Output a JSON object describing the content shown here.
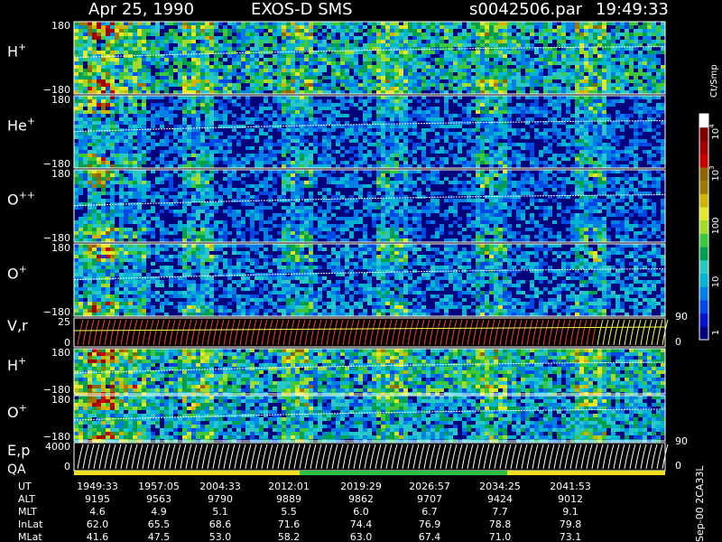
{
  "header": {
    "date": "Apr 25, 1990",
    "instrument": "EXOS-D SMS",
    "file": "s0042506.par",
    "time": "19:49:33"
  },
  "footer_tag": "Sep-00 2CA33L",
  "chart_data": {
    "type": "heatmap",
    "panels": [
      {
        "label": "H",
        "sup": "+",
        "y_top": "180",
        "y_bottom": "−180",
        "kind": "spec",
        "bg": 0.1,
        "noise": 0.45
      },
      {
        "label": "He",
        "sup": "+",
        "y_top": "180",
        "y_bottom": "−180",
        "kind": "spec",
        "bg": 0.06,
        "noise": 0.25
      },
      {
        "label": "O",
        "sup": "++",
        "y_top": "180",
        "y_bottom": "−180",
        "kind": "spec",
        "bg": 0.05,
        "noise": 0.25
      },
      {
        "label": "O",
        "sup": "+",
        "y_top": "180",
        "y_bottom": "−180",
        "kind": "spec",
        "bg": 0.06,
        "noise": 0.3
      },
      {
        "label": "V,r",
        "sup": "",
        "y_top": "25",
        "y_bottom": "0",
        "right_top": "90",
        "right_bottom": "0",
        "kind": "vr"
      },
      {
        "label": "H",
        "sup": "+",
        "y_top": "180",
        "y_bottom": "−180",
        "kind": "spec",
        "bg": 0.12,
        "noise": 0.45
      },
      {
        "label": "O",
        "sup": "+",
        "y_top": "180",
        "y_bottom": "−180",
        "kind": "spec",
        "bg": 0.1,
        "noise": 0.35
      },
      {
        "label": "E,p",
        "sup": "",
        "label2": "QA",
        "y_top": "4000",
        "y_bottom": "0",
        "right_top": "90",
        "right_bottom": "0",
        "kind": "ep"
      }
    ],
    "colorbar": {
      "unit": "Ct/Smp",
      "ticks": [
        "1",
        "10",
        "100",
        "10",
        "10"
      ],
      "tick_exponents": [
        "",
        "",
        "",
        "3",
        "4"
      ],
      "colors": [
        "#00007a",
        "#0015c8",
        "#0048e6",
        "#0080e6",
        "#00b4d2",
        "#28c8c8",
        "#00a050",
        "#3cc83c",
        "#a0dc28",
        "#e6e628",
        "#d2b400",
        "#a07800",
        "#8c6400",
        "#c80000",
        "#a00000",
        "#800000",
        "#ffffff"
      ]
    },
    "time_axis": {
      "rows": [
        {
          "label": "UT",
          "values": [
            "1949:33",
            "1957:05",
            "2004:33",
            "2012:01",
            "2019:29",
            "2026:57",
            "2034:25",
            "2041:53"
          ]
        },
        {
          "label": "ALT",
          "values": [
            "9195",
            "9563",
            "9790",
            "9889",
            "9862",
            "9707",
            "9424",
            "9012"
          ]
        },
        {
          "label": "MLT",
          "values": [
            "4.6",
            "4.9",
            "5.1",
            "5.5",
            "6.0",
            "6.7",
            "7.7",
            "9.1"
          ]
        },
        {
          "label": "InLat",
          "values": [
            "62.0",
            "65.5",
            "68.6",
            "71.6",
            "74.4",
            "76.9",
            "78.8",
            "79.8"
          ]
        },
        {
          "label": "MLat",
          "values": [
            "41.6",
            "47.5",
            "53.0",
            "58.2",
            "63.0",
            "67.4",
            "71.0",
            "73.1"
          ]
        }
      ]
    }
  }
}
